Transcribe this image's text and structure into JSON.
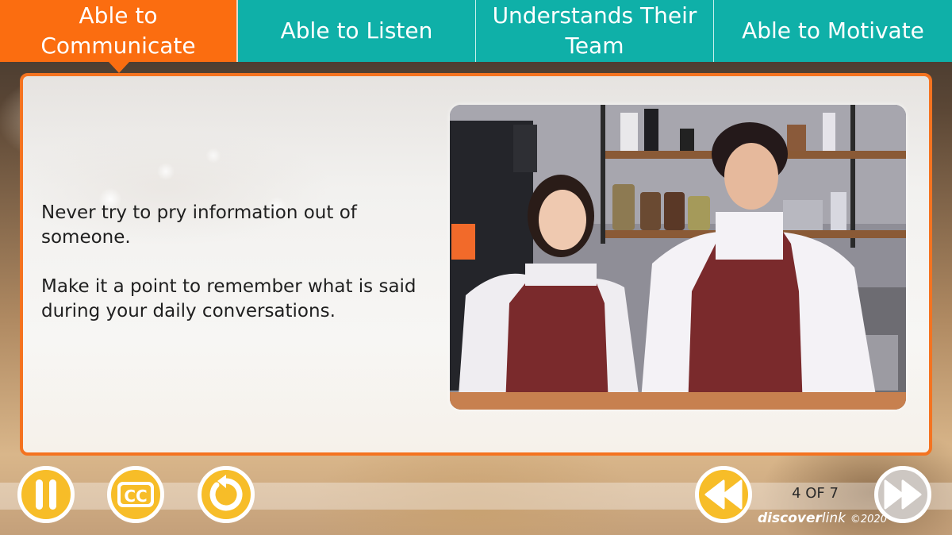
{
  "tabs": [
    {
      "label": "Able to Communicate",
      "line1": "Able to",
      "line2": "Communicate",
      "active": true
    },
    {
      "label": "Able to Listen",
      "active": false
    },
    {
      "label": "Understands Their Team",
      "line1": "Understands Their",
      "line2": "Team",
      "active": false
    },
    {
      "label": "Able to Motivate",
      "active": false
    }
  ],
  "colors": {
    "active_tab": "#fb6d10",
    "inactive_tab": "#0fb0a8",
    "card_border": "#f47320",
    "control_button": "#f7bd28",
    "control_button_disabled": "#cdc7c2"
  },
  "content": {
    "paragraphs": [
      "Never try to pry information out of someone.",
      "Make it a point to remember what is said during your daily conversations."
    ],
    "image_alt": "Two baristas in maroon aprons smiling at each other behind a cafe counter"
  },
  "controls": {
    "pause_icon": "pause-icon",
    "cc_icon": "closed-captions-icon",
    "cc_label": "CC",
    "replay_icon": "replay-icon",
    "prev_icon": "rewind-icon",
    "next_icon": "fast-forward-icon",
    "next_disabled": true
  },
  "pagination": {
    "current": 4,
    "total": 7,
    "text": "4 OF 7"
  },
  "branding": {
    "name_bold": "discover",
    "name_light": "link",
    "copyright": "©2020"
  }
}
